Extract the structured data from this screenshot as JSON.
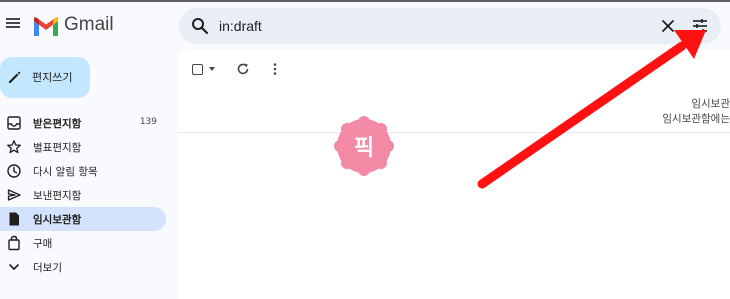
{
  "header": {
    "app_name": "Gmail",
    "menu_icon": "hamburger-menu-icon",
    "logo_icon": "gmail-m-logo",
    "brand_colors": {
      "red": "#ea4335",
      "blue": "#4285f4",
      "green": "#34a853",
      "yellow": "#fbbc04"
    }
  },
  "search": {
    "value": "in:draft",
    "icon": "search-icon",
    "clear_icon": "close-icon",
    "options_icon": "tune-icon"
  },
  "sidebar": {
    "compose_label": "편지쓰기",
    "compose_color": "#c2e7ff",
    "active_color": "#d3e3fd",
    "items": [
      {
        "label": "받은편지함",
        "count": "139",
        "icon": "inbox-icon",
        "bold": true
      },
      {
        "label": "별표편지함",
        "icon": "star-icon"
      },
      {
        "label": "다시 알림 항목",
        "icon": "clock-icon"
      },
      {
        "label": "보낸편지함",
        "icon": "send-icon"
      },
      {
        "label": "임시보관함",
        "icon": "draft-icon",
        "active": true
      },
      {
        "label": "구매",
        "icon": "shopping-bag-icon"
      },
      {
        "label": "더보기",
        "icon": "chevron-down-icon"
      }
    ]
  },
  "main": {
    "empty_title": "임시보관",
    "empty_desc": "임시보관함에는"
  },
  "overlay": {
    "stamp_text": "픽",
    "stamp_color": "#f28aa5",
    "arrow_color": "#ff1111"
  }
}
